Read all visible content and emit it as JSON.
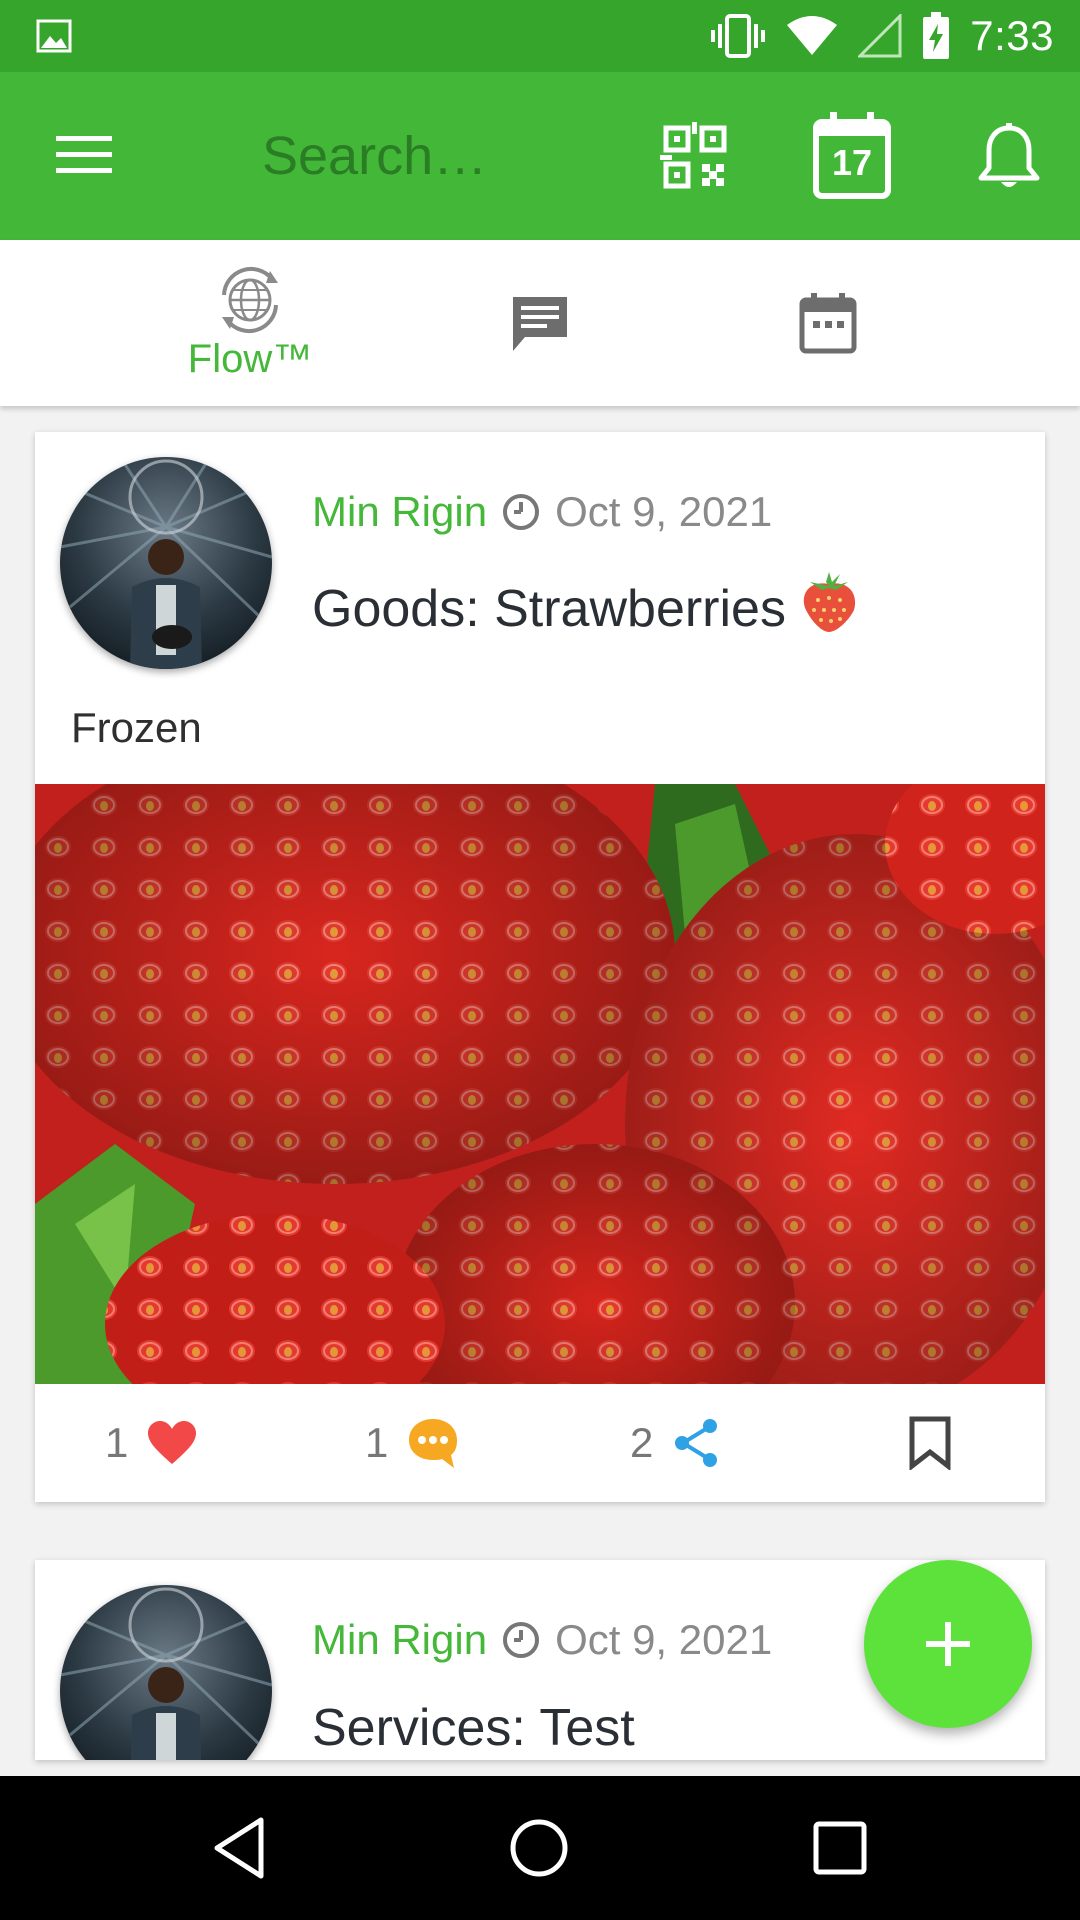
{
  "status_bar": {
    "time": "7:33",
    "icons": [
      "image-icon",
      "vibrate-icon",
      "wifi-icon",
      "cell-signal-icon",
      "battery-charging-icon"
    ]
  },
  "app_bar": {
    "search_placeholder": "Search…",
    "calendar_day": "17",
    "icons": [
      "menu-icon",
      "qr-code-icon",
      "calendar-icon",
      "bell-icon"
    ],
    "background": "#43b838"
  },
  "tabs": [
    {
      "label": "Flow™",
      "icon": "globe-sync-icon",
      "active": true
    },
    {
      "label": "",
      "icon": "chat-icon",
      "active": false
    },
    {
      "label": "",
      "icon": "calendar-icon",
      "active": false
    }
  ],
  "posts": [
    {
      "author": "Min Rigin",
      "date": "Oct 9, 2021",
      "title": "Goods: Strawberries",
      "title_icon": "strawberry-icon",
      "description": "Frozen",
      "image": "strawberries-photo",
      "likes": "1",
      "comments": "1",
      "shares": "2"
    },
    {
      "author": "Min Rigin",
      "date": "Oct 9, 2021",
      "title": "Services: Test"
    }
  ],
  "colors": {
    "accent": "#45b83a",
    "status_bar": "#36a52b",
    "like": "#f24848",
    "comment": "#f7a823",
    "share": "#2fa2e6",
    "fab": "#5ce23a"
  }
}
